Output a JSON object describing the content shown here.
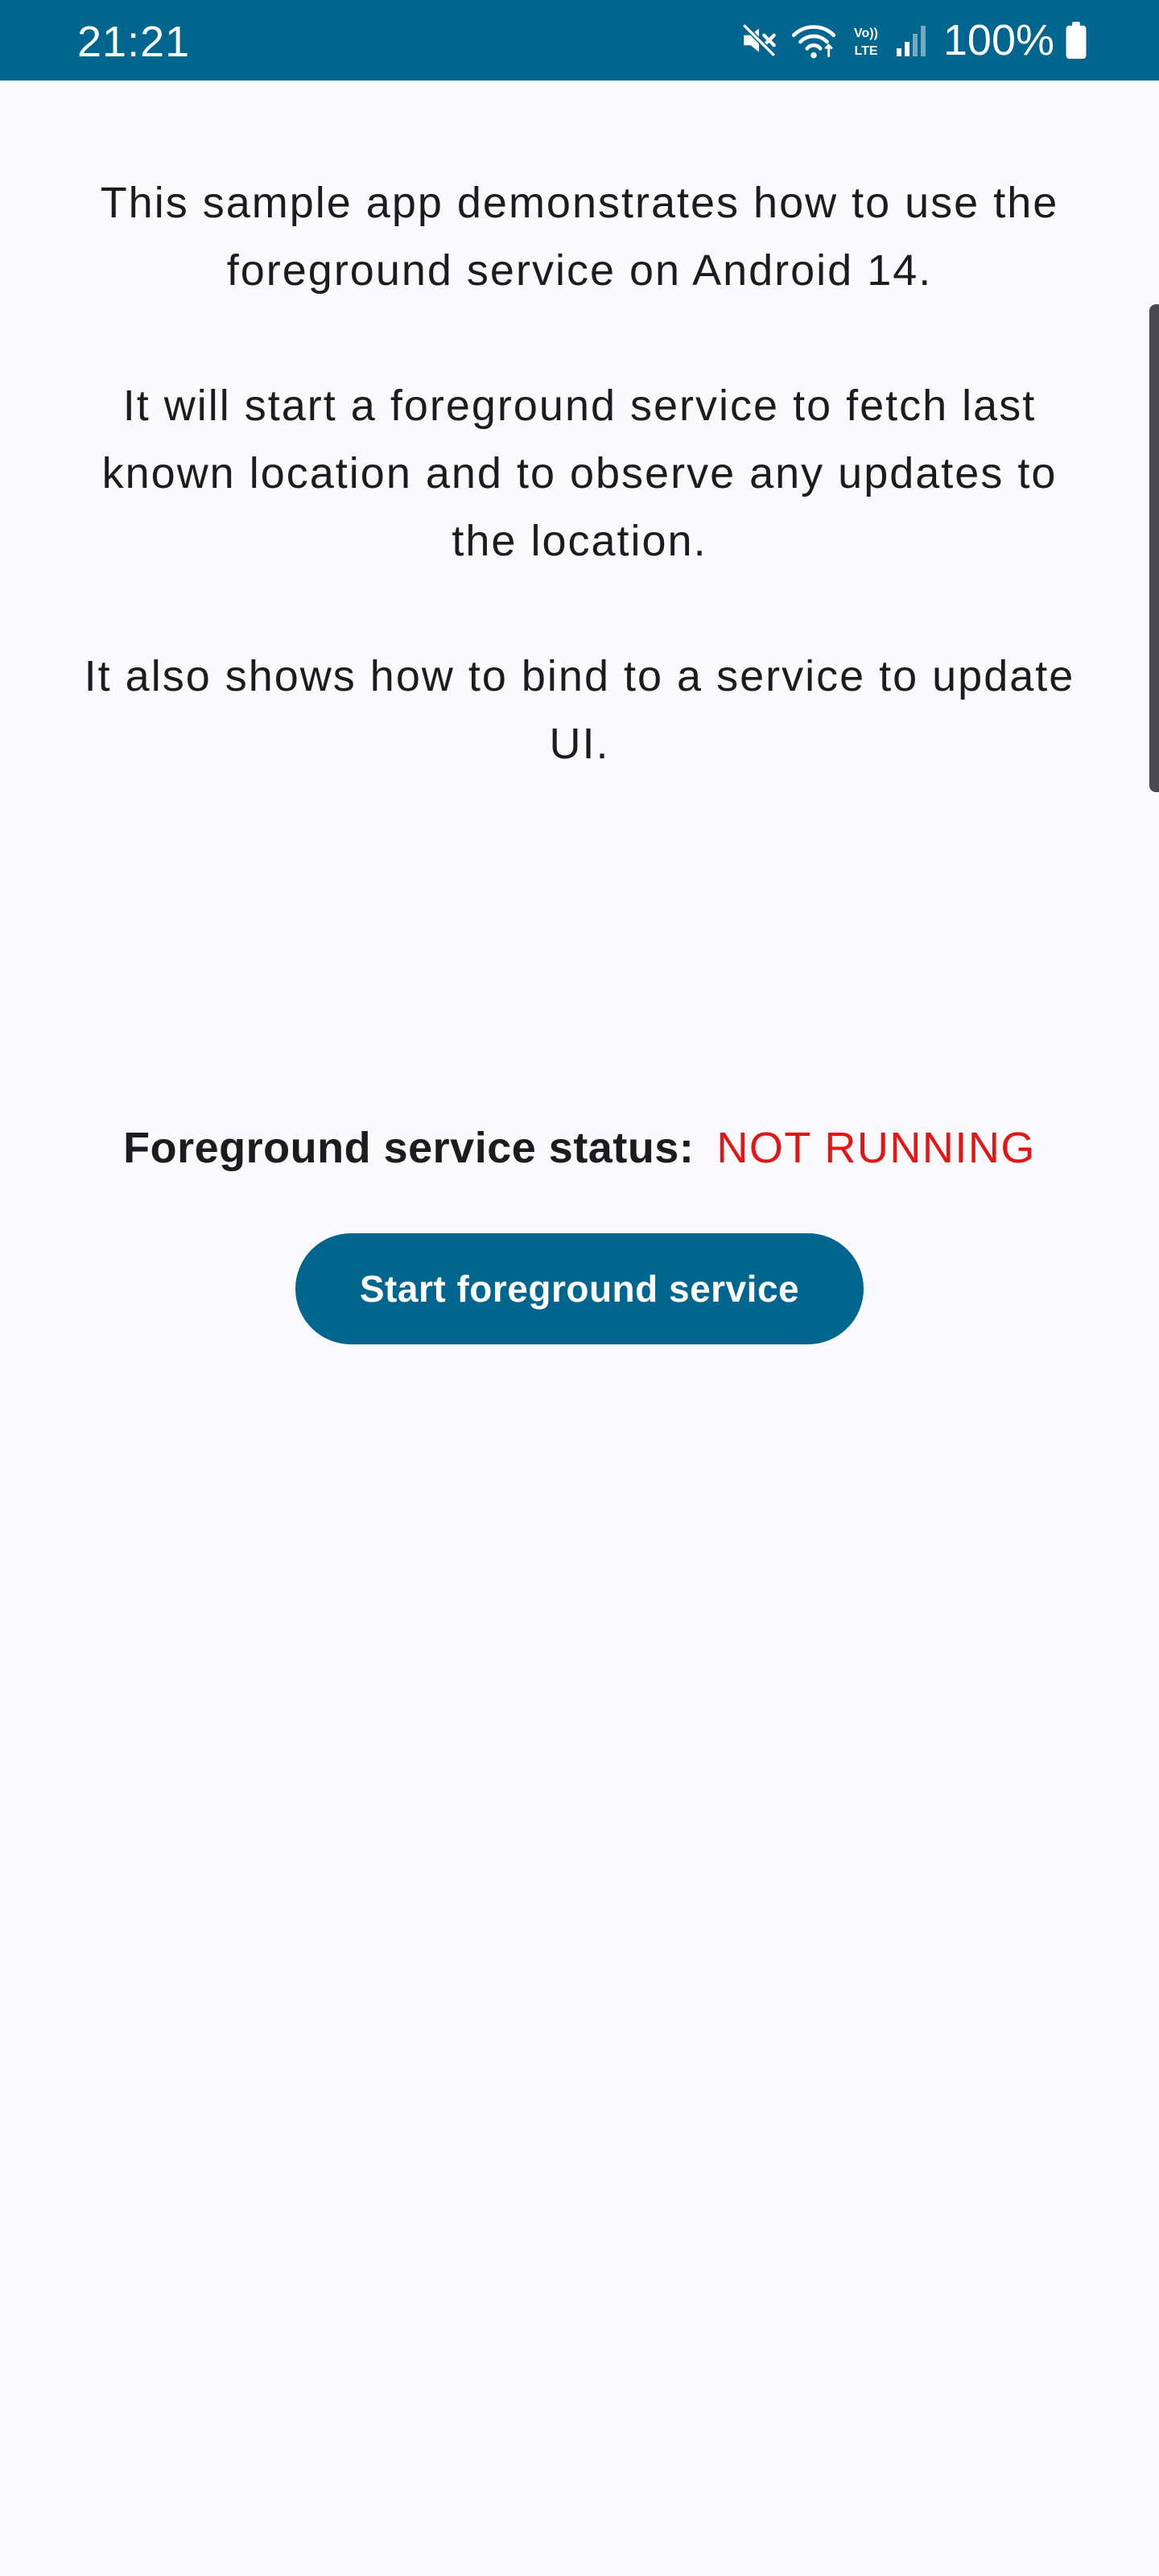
{
  "status_bar": {
    "time": "21:21",
    "battery": "100%",
    "icons": [
      "mute-icon",
      "wifi-icon",
      "volte-icon",
      "signal-icon",
      "battery-icon"
    ]
  },
  "content": {
    "paragraphs": [
      "This sample app demonstrates how to use the foreground service on Android 14.",
      "It will start a foreground service to fetch last known location and to observe any updates to the location.",
      "It also shows how to bind to a service to update UI."
    ],
    "status_label": "Foreground service status:",
    "status_value": "NOT RUNNING",
    "start_button_label": "Start foreground service"
  },
  "colors": {
    "primary": "#00658f",
    "background": "#fafafd",
    "status_not_running": "#e31616"
  }
}
